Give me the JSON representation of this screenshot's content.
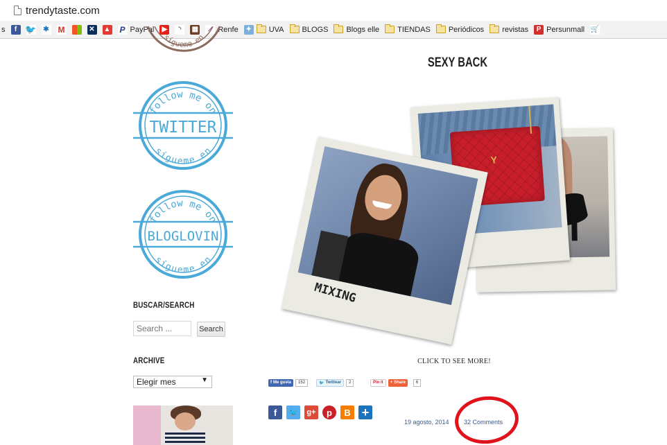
{
  "browser": {
    "url": "trendytaste.com",
    "bookmarks": [
      {
        "label": "PayPal"
      },
      {
        "label": "Renfe"
      },
      {
        "label": "UVA"
      },
      {
        "label": "BLOGS"
      },
      {
        "label": "Blogs elle"
      },
      {
        "label": "TIENDAS"
      },
      {
        "label": "Periódicos"
      },
      {
        "label": "revistas"
      },
      {
        "label": "Persunmall"
      }
    ]
  },
  "sidebar": {
    "stamp_follow": "follow me on",
    "stamp_sigueme": "sígueme en",
    "stamp_twitter": "TWITTER",
    "stamp_bloglovin": "BLOGLOVIN",
    "search_title": "BUSCAR/SEARCH",
    "search_placeholder": "Search ...",
    "search_button": "Search",
    "archive_title": "ARCHIVE",
    "archive_selected": "Elegir mes"
  },
  "post": {
    "title": "SEXY BACK",
    "collage_label": "MIXING",
    "click_more": "CLICK TO SEE MORE!",
    "share": {
      "fb_label": "Me gusta",
      "fb_count": "152",
      "tw_label": "Twittear",
      "tw_count": "2",
      "pin_label": "Pin it",
      "share_label": "Share",
      "share_count": "6"
    },
    "date": "19 agosto, 2014",
    "comments": "32 Comments"
  },
  "colors": {
    "stamp_blue": "#4aa9d8",
    "highlight_circle": "#e0131d",
    "facebook": "#3b5998",
    "twitter": "#55acee",
    "googleplus": "#dd4b39",
    "pinterest": "#cb2027",
    "blogger": "#f57d00",
    "addthis": "#1e73be"
  }
}
